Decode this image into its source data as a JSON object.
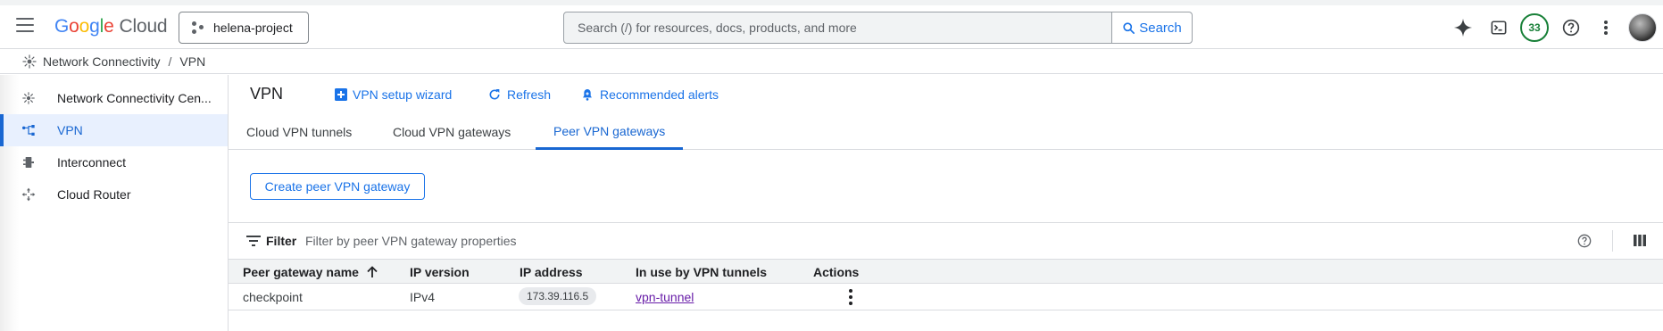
{
  "header": {
    "logo_google": "Google",
    "logo_cloud": "Cloud",
    "project": "helena-project",
    "search_placeholder": "Search (/) for resources, docs, products, and more",
    "search_button": "Search",
    "notifications_count": "33"
  },
  "breadcrumb": {
    "items": [
      "Network Connectivity",
      "VPN"
    ],
    "separator": "/"
  },
  "sidebar": {
    "items": [
      {
        "label": "Network Connectivity Cen...",
        "icon": "hub-icon",
        "active": false
      },
      {
        "label": "VPN",
        "icon": "vpn-icon",
        "active": true
      },
      {
        "label": "Interconnect",
        "icon": "interconnect-icon",
        "active": false
      },
      {
        "label": "Cloud Router",
        "icon": "router-icon",
        "active": false
      }
    ]
  },
  "page": {
    "title": "VPN",
    "actions": [
      "VPN setup wizard",
      "Refresh",
      "Recommended alerts"
    ]
  },
  "tabs": [
    {
      "label": "Cloud VPN tunnels",
      "active": false
    },
    {
      "label": "Cloud VPN gateways",
      "active": false
    },
    {
      "label": "Peer VPN gateways",
      "active": true
    }
  ],
  "create_button": "Create peer VPN gateway",
  "filter": {
    "label": "Filter",
    "placeholder": "Filter by peer VPN gateway properties"
  },
  "table": {
    "columns": [
      "Peer gateway name",
      "IP version",
      "IP address",
      "In use by VPN tunnels",
      "Actions"
    ],
    "sort_column": "Peer gateway name",
    "sort_direction": "ascending",
    "rows": [
      {
        "name": "checkpoint",
        "ip_version": "IPv4",
        "ip_address": "173.39.116.5",
        "tunnels": "vpn-tunnel"
      }
    ]
  },
  "colors": {
    "accent": "#1a73e8",
    "active_nav_bg": "#e8f0fe",
    "link_visited": "#681da8",
    "badge_green": "#188038"
  }
}
